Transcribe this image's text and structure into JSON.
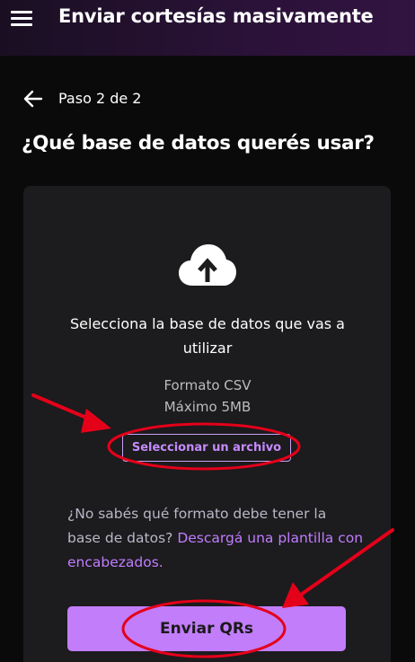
{
  "header": {
    "title": "Enviar cortesías masivamente",
    "menu_icon": "hamburger-menu-icon"
  },
  "step": {
    "back_icon": "arrow-left-icon",
    "label": "Paso 2 de 2"
  },
  "question": "¿Qué base de datos querés usar?",
  "upload": {
    "icon": "cloud-upload-icon",
    "instruction": "Selecciona la base de datos que vas a utilizar",
    "format_line": "Formato CSV",
    "size_line": "Máximo 5MB",
    "button_label": "Seleccionar un archivo"
  },
  "help": {
    "text": "¿No sabés qué formato debe tener la base de datos? ",
    "link_text": "Descargá una plantilla con encabezados."
  },
  "submit": {
    "label": "Enviar QRs"
  },
  "colors": {
    "accent": "#c27dfa",
    "link": "#c07dff",
    "card": "#1c1b1d",
    "annotation": "#e5001a"
  }
}
